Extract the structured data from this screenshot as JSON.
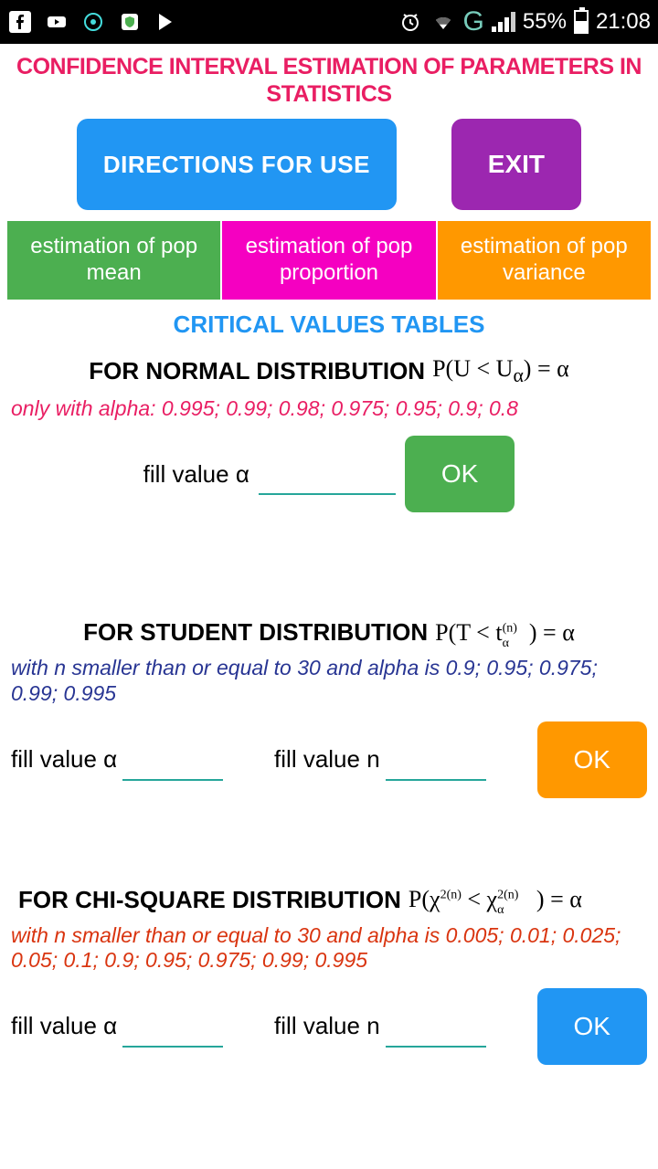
{
  "status": {
    "battery_percent": "55%",
    "time": "21:08",
    "network_letter": "G"
  },
  "title": "CONFIDENCE INTERVAL ESTIMATION OF PARAMETERS IN STATISTICS",
  "buttons": {
    "directions": "DIRECTIONS FOR USE",
    "exit": "EXIT"
  },
  "tabs": {
    "mean": "estimation of pop mean",
    "proportion": "estimation of pop proportion",
    "variance": "estimation of pop variance"
  },
  "tables_heading": "CRITICAL VALUES TABLES",
  "normal": {
    "title": "FOR NORMAL DISTRIBUTION",
    "formula": "P(U < Uₐ) = α",
    "note": "only with alpha: 0.995; 0.99; 0.98; 0.975; 0.95; 0.9; 0.8",
    "fill_alpha": "fill value α",
    "ok": "OK"
  },
  "student": {
    "title": "FOR STUDENT DISTRIBUTION",
    "formula_pre": "P(T < t",
    "formula_post": ") = α",
    "note": "with n smaller than or equal to 30 and alpha is 0.9; 0.95; 0.975; 0.99; 0.995",
    "fill_alpha": "fill value α",
    "fill_n": "fill value n",
    "ok": "OK"
  },
  "chisq": {
    "title": "FOR CHI-SQUARE DISTRIBUTION",
    "formula_pre": "P(χ",
    "formula_post": ") = α",
    "note": "with n smaller than or equal to 30 and alpha is 0.005; 0.01; 0.025; 0.05; 0.1; 0.9; 0.95; 0.975; 0.99; 0.995",
    "fill_alpha": "fill value α",
    "fill_n": "fill value n",
    "ok": "OK"
  }
}
